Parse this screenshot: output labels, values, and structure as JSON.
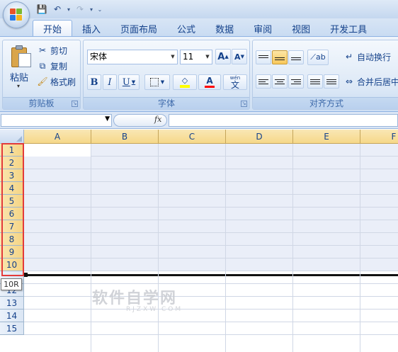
{
  "quick_access": {
    "icons": [
      "save-icon",
      "undo-icon",
      "redo-icon",
      "customize-icon"
    ]
  },
  "tabs": [
    {
      "label": "开始",
      "active": true
    },
    {
      "label": "插入",
      "active": false
    },
    {
      "label": "页面布局",
      "active": false
    },
    {
      "label": "公式",
      "active": false
    },
    {
      "label": "数据",
      "active": false
    },
    {
      "label": "审阅",
      "active": false
    },
    {
      "label": "视图",
      "active": false
    },
    {
      "label": "开发工具",
      "active": false
    }
  ],
  "clipboard": {
    "paste_label": "粘贴",
    "cut_label": "剪切",
    "copy_label": "复制",
    "format_painter_label": "格式刷",
    "group_label": "剪贴板"
  },
  "font": {
    "font_name": "宋体",
    "font_size": "11",
    "grow_label": "A",
    "shrink_label": "A",
    "bold_label": "B",
    "italic_label": "I",
    "underline_label": "U",
    "font_color_label": "A",
    "phonetic_label": "文",
    "phonetic_top": "wén",
    "group_label": "字体",
    "colors": {
      "highlight": "#ffff00",
      "font_color": "#ff0000"
    }
  },
  "alignment": {
    "wrap_text_label": "自动换行",
    "merge_label": "合并后居中",
    "group_label": "对齐方式"
  },
  "formula_bar": {
    "fx_label": "fx",
    "name_box_value": "",
    "formula_value": ""
  },
  "grid": {
    "columns": [
      "A",
      "B",
      "C",
      "D",
      "E",
      "F"
    ],
    "rows": [
      "1",
      "2",
      "3",
      "4",
      "5",
      "6",
      "7",
      "8",
      "9",
      "10",
      "",
      "12",
      "13",
      "14",
      "15"
    ],
    "selected_rows": 10,
    "tooltip": "10R",
    "selection_border_color": "#e33a3a"
  },
  "watermark": {
    "text": "软件自学网",
    "sub": "RJZXW.COM"
  }
}
